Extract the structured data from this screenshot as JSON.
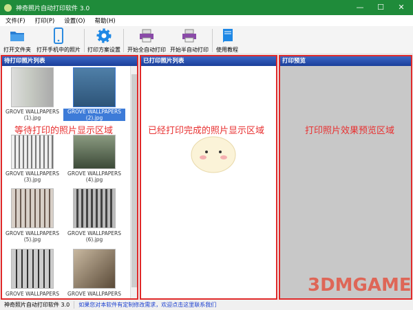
{
  "window": {
    "title": "神奇照片自动打印软件 3.0",
    "minimize": "—",
    "maximize": "☐",
    "close": "✕"
  },
  "menu": [
    "文件(F)",
    "打印(P)",
    "设置(O)",
    "帮助(H)"
  ],
  "toolbar": [
    {
      "label": "打开文件夹",
      "icon": "folder-icon"
    },
    {
      "label": "打开手机中的照片",
      "icon": "phone-icon"
    },
    {
      "label": "打印方案设置",
      "icon": "gear-icon"
    },
    {
      "label": "开始全自动打印",
      "icon": "printer-icon"
    },
    {
      "label": "开始半自动打印",
      "icon": "printer-icon"
    },
    {
      "label": "使用教程",
      "icon": "book-icon"
    }
  ],
  "panels": {
    "pending": {
      "title": "待打印照片列表",
      "note": "等待打印的照片显示区域",
      "photos": [
        {
          "name": "GROVE WALLPAPERS (1).jpg",
          "line1": "GROVE WALLPAPERS",
          "line2": "(1).jpg",
          "selected": false
        },
        {
          "name": "GROVE WALLPAPERS (2).jpg",
          "line1": "GROVE WALLPAPERS",
          "line2": "(2).jpg",
          "selected": true
        },
        {
          "name": "GROVE WALLPAPERS (3).jpg",
          "line1": "GROVE WALLPAPERS",
          "line2": "(3).jpg",
          "selected": false
        },
        {
          "name": "GROVE WALLPAPERS (4).jpg",
          "line1": "GROVE WALLPAPERS",
          "line2": "(4).jpg",
          "selected": false
        },
        {
          "name": "GROVE WALLPAPERS (5).jpg",
          "line1": "GROVE WALLPAPERS",
          "line2": "(5).jpg",
          "selected": false
        },
        {
          "name": "GROVE WALLPAPERS (6).jpg",
          "line1": "GROVE WALLPAPERS",
          "line2": "(6).jpg",
          "selected": false
        },
        {
          "name": "GROVE WALLPAPERS",
          "line1": "GROVE WALLPAPERS",
          "line2": "",
          "selected": false
        },
        {
          "name": "GROVE WALLPAPERS",
          "line1": "GROVE WALLPAPERS",
          "line2": "",
          "selected": false
        }
      ]
    },
    "printed": {
      "title": "已打印照片列表",
      "note": "已经打印完成的照片显示区域"
    },
    "preview": {
      "title": "打印预览",
      "note": "打印照片效果预览区域"
    }
  },
  "status": {
    "app": "神奇照片自动打印软件 3.0",
    "link": "如果您对本软件有定制修改需求，欢迎点击这里联系我们"
  },
  "watermark": "3DMGAME"
}
